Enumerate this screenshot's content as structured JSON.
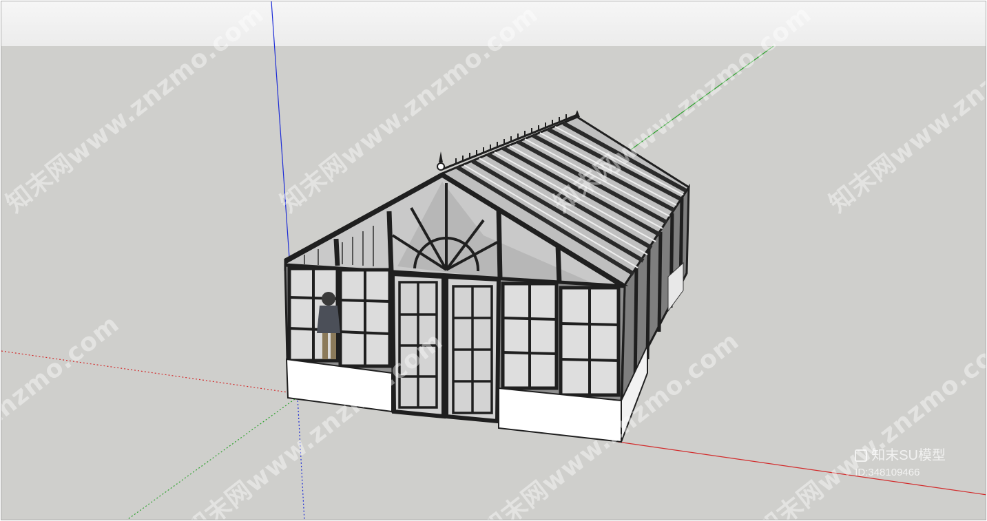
{
  "viewport": {
    "background": "#cfcfcc",
    "sky": "#f0f0f0",
    "axis_colors": {
      "red": "#d22a2a",
      "green": "#2aa12a",
      "blue": "#1c2bd6"
    }
  },
  "watermark": {
    "text": "知末网www.znzmo.com"
  },
  "badge": {
    "brand": "知末SU模型",
    "id_text": "ID:348109466"
  },
  "model": {
    "name": "greenhouse-conservatory"
  }
}
